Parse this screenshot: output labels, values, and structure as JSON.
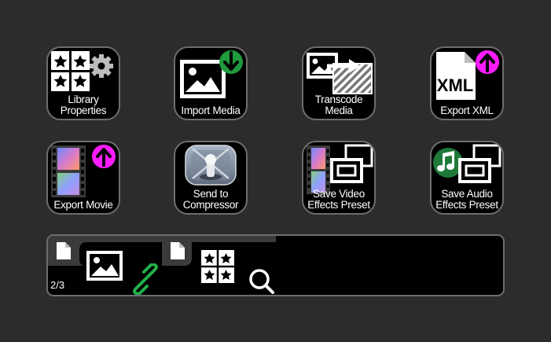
{
  "tiles": [
    {
      "id": "library-properties",
      "label": "Library\nProperties"
    },
    {
      "id": "import-media",
      "label": "Import Media"
    },
    {
      "id": "transcode-media",
      "label": "Transcode\nMedia"
    },
    {
      "id": "export-xml",
      "label": "Export XML",
      "badge_text": "XML"
    },
    {
      "id": "export-movie",
      "label": "Export Movie"
    },
    {
      "id": "send-to-compressor",
      "label": "Send to\nCompressor"
    },
    {
      "id": "save-video-effects-preset",
      "label": "Save Video\nEffects Preset"
    },
    {
      "id": "save-audio-effects-preset",
      "label": "Save Audio\nEffects Preset"
    }
  ],
  "bottom_bar": {
    "page_indicator": "2/3",
    "icons": [
      "document-icon",
      "image-icon",
      "link-icon",
      "document-icon",
      "grid-stars-icon",
      "search-icon"
    ]
  },
  "colors": {
    "background": "#2c2c2c",
    "tile_bg": "#000000",
    "tile_border": "#6e6e6e",
    "green_accent": "#1f9a3c",
    "magenta_accent": "#ff1dff",
    "link_green": "#22b04a"
  }
}
